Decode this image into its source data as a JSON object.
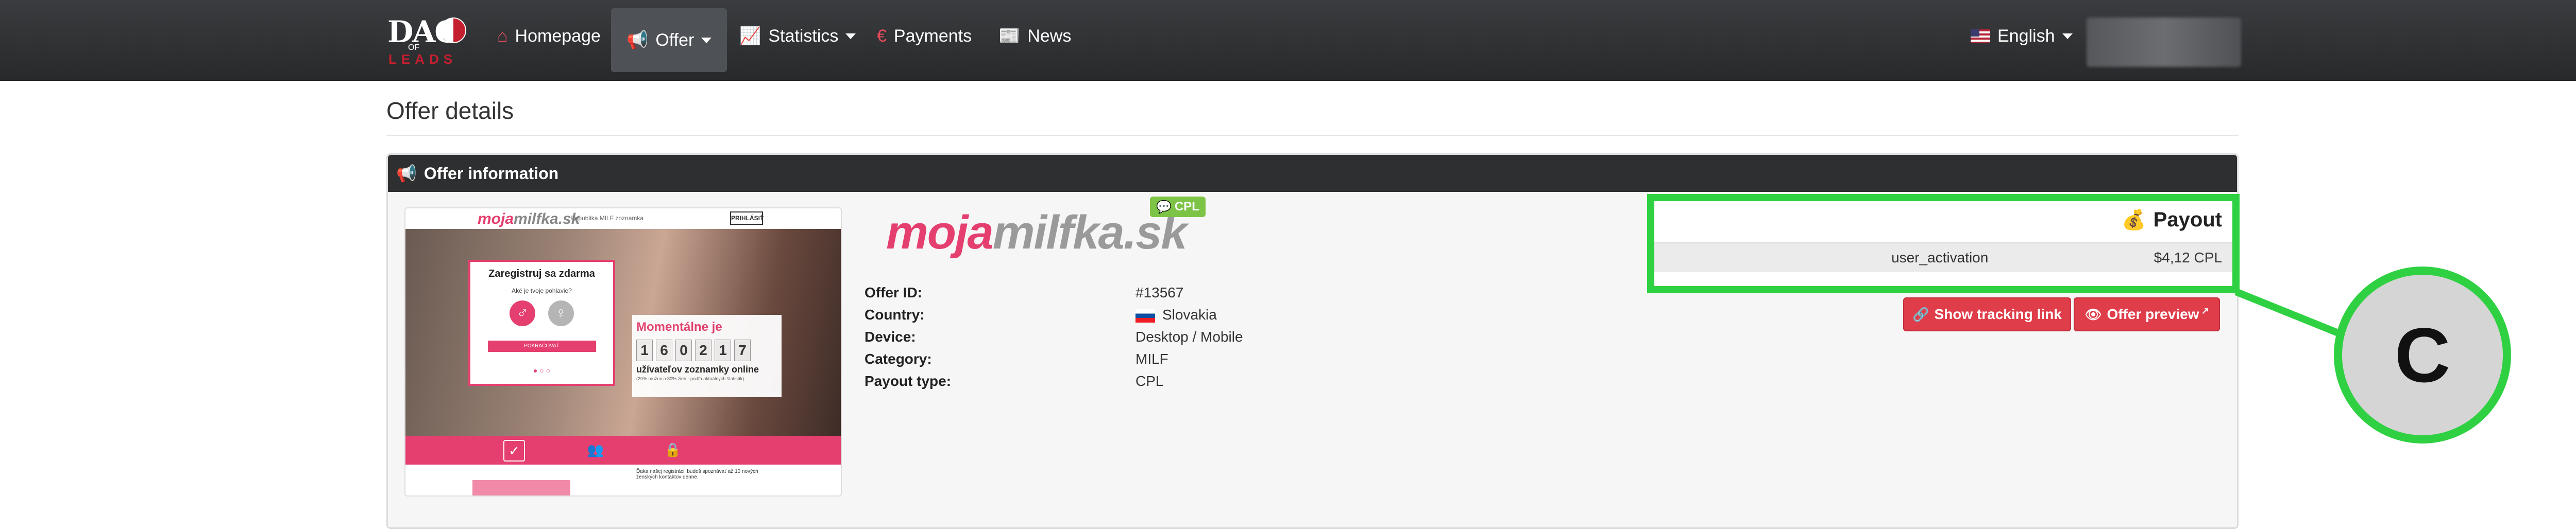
{
  "navbar": {
    "logo": {
      "main": "DAO",
      "of": "OF",
      "sub": "LEADS"
    },
    "items": [
      {
        "label": "Homepage",
        "icon": "home-icon"
      },
      {
        "label": "Offer",
        "icon": "bullhorn-icon"
      },
      {
        "label": "Statistics",
        "icon": "chart-icon"
      },
      {
        "label": "Payments",
        "icon": "euro-icon"
      },
      {
        "label": "News",
        "icon": "newspaper-icon"
      }
    ],
    "language": "English"
  },
  "page": {
    "title": "Offer details"
  },
  "panel": {
    "title": "Offer information"
  },
  "preview": {
    "logo_a": "moja",
    "logo_b": "milfka.sk",
    "small": "Republika MILF zoznamka",
    "top_btn": "PRIHLÁSIŤ",
    "form_title": "Zaregistruj sa zdarma",
    "form_q": "Aké je tvoje pohlavie?",
    "form_btn": "POKRAČOVAŤ",
    "count_head": "Momentálne je",
    "digits": [
      "1",
      "6",
      "0",
      "2",
      "1",
      "7"
    ],
    "count_text": "užívateľov zoznamky online",
    "count_small": "(20% mužov a 80% žien - podľa aktuálnych štatistík)",
    "bottom_text": "Ďaka našej registrácii budeš spoznávať až 10 nových ženských kontaktov denne."
  },
  "offer": {
    "logo_a": "moja",
    "logo_b": "milfka.sk",
    "badge": "CPL",
    "fields": [
      {
        "label": "Offer ID:",
        "value": "#13567"
      },
      {
        "label": "Country:",
        "value": "Slovakia"
      },
      {
        "label": "Device:",
        "value": "Desktop / Mobile"
      },
      {
        "label": "Category:",
        "value": "MILF"
      },
      {
        "label": "Payout type:",
        "value": "CPL"
      }
    ]
  },
  "payout": {
    "title": "Payout",
    "event": "user_activation",
    "amount": "$4,12 CPL"
  },
  "buttons": {
    "tracking": "Show tracking link",
    "preview": "Offer preview"
  },
  "annotation": {
    "label": "C",
    "color": "#2fd142"
  }
}
